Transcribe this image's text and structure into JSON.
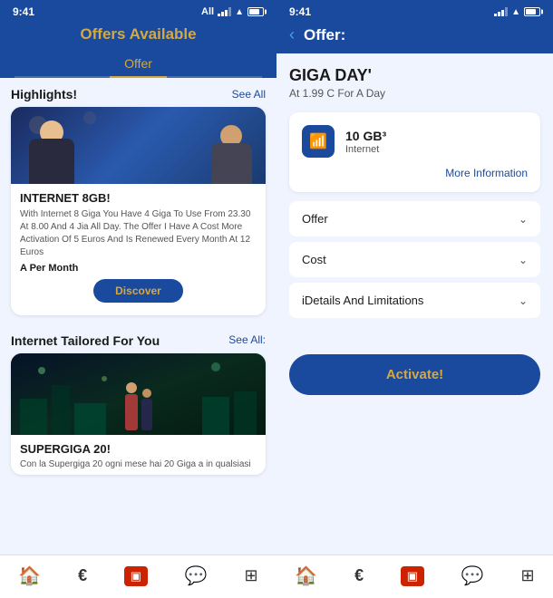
{
  "left": {
    "statusBar": {
      "time": "9:41",
      "carrier": "All",
      "rightTime": "9:41"
    },
    "header": {
      "title": "Offers Available"
    },
    "tabs": [
      {
        "label": "Offer",
        "active": true
      }
    ],
    "sections": [
      {
        "id": "highlights",
        "title": "Highlights!",
        "seeAll": "See All"
      },
      {
        "id": "internet",
        "title": "Internet Tailored For You",
        "seeAll": "See All:"
      }
    ],
    "cards": [
      {
        "id": "internet8gb",
        "title": "INTERNET 8GB!",
        "desc": "With Internet 8 Giga You Have 4 Giga To Use From 23.30 At 8.00 And 4 Jia All Day. The Offer I Have A Cost More Activation Of 5 Euros And Is Renewed Every Month At 12 Euros",
        "price": "A Per Month",
        "buttonLabel": "Discover"
      },
      {
        "id": "supergiga20",
        "title": "SUPERGIGA 20!",
        "desc": "Con la Supergiga 20 ogni mese hai 20 Giga a in qualsiasi"
      }
    ],
    "bottomNav": [
      {
        "id": "home",
        "icon": "🏠",
        "label": ""
      },
      {
        "id": "euro",
        "icon": "€",
        "label": ""
      },
      {
        "id": "sim",
        "icon": "▣",
        "label": ""
      },
      {
        "id": "chat",
        "icon": "💬",
        "label": ""
      },
      {
        "id": "grid",
        "icon": "⊞",
        "label": ""
      }
    ]
  },
  "right": {
    "statusBar": {
      "time": "9:41"
    },
    "header": {
      "backLabel": "‹",
      "title": "Offer:"
    },
    "offerTitle": "GIGA DAY'",
    "offerSubtitle": "At 1.99 C For A Day",
    "gigaCard": {
      "amount": "10 GB³",
      "label": "Internet",
      "moreInfo": "More Information"
    },
    "accordion": [
      {
        "id": "offer",
        "label": "Offer"
      },
      {
        "id": "cost",
        "label": "Cost"
      },
      {
        "id": "details",
        "label": "iDetails And Limitations"
      }
    ],
    "activateButton": "Activate!"
  }
}
